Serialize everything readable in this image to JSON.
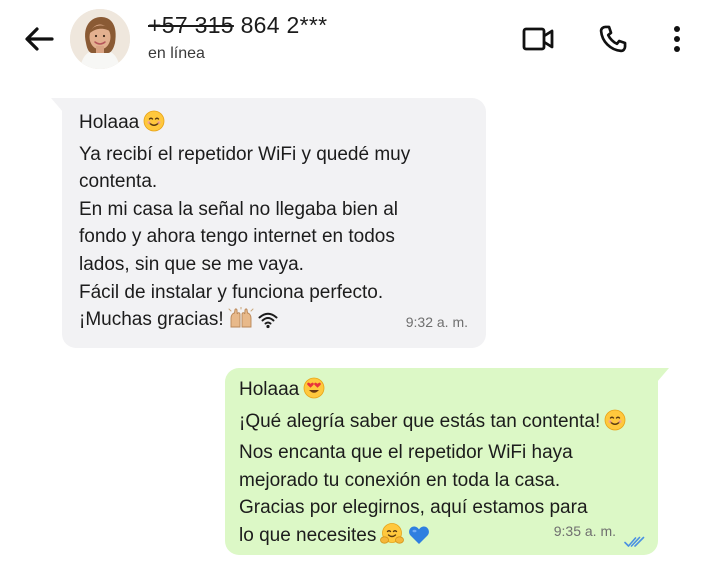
{
  "header": {
    "phone_struck": "+57 315",
    "phone_rest": " 864 2***",
    "status": "en línea",
    "icons": [
      "back-arrow-icon",
      "avatar",
      "video-camera-icon",
      "phone-icon",
      "more-vert-icon"
    ]
  },
  "messages": {
    "incoming": {
      "lines": [
        "Holaaa",
        "Ya recibí el repetidor WiFi y quedé muy",
        "contenta.",
        "En mi casa la señal no llegaba bien al",
        "fondo y ahora tengo internet en todos",
        "lados, sin que se me vaya.",
        "Fácil de instalar y funciona perfecto.",
        "¡Muchas gracias!"
      ],
      "time": "9:32 a. m.",
      "emojis": [
        "smiling-face-emoji",
        "raising-hands-emoji",
        "wifi-icon"
      ]
    },
    "outgoing": {
      "lines": [
        "Holaaa",
        "¡Qué alegría saber que estás tan contenta!",
        "Nos encanta que el repetidor WiFi haya",
        "mejorado tu conexión en toda la casa.",
        "Gracias por elegirnos, aquí estamos para",
        "lo que necesites"
      ],
      "time": "9:35 a. m.",
      "status": "read",
      "emojis": [
        "heart-eyes-emoji",
        "smiling-face-emoji",
        "hugging-face-emoji",
        "blue-heart-emoji"
      ]
    }
  },
  "colors": {
    "incoming_bubble": "#f2f2f4",
    "outgoing_bubble": "#dcf8c6",
    "read_ticks": "#4a90e2"
  }
}
